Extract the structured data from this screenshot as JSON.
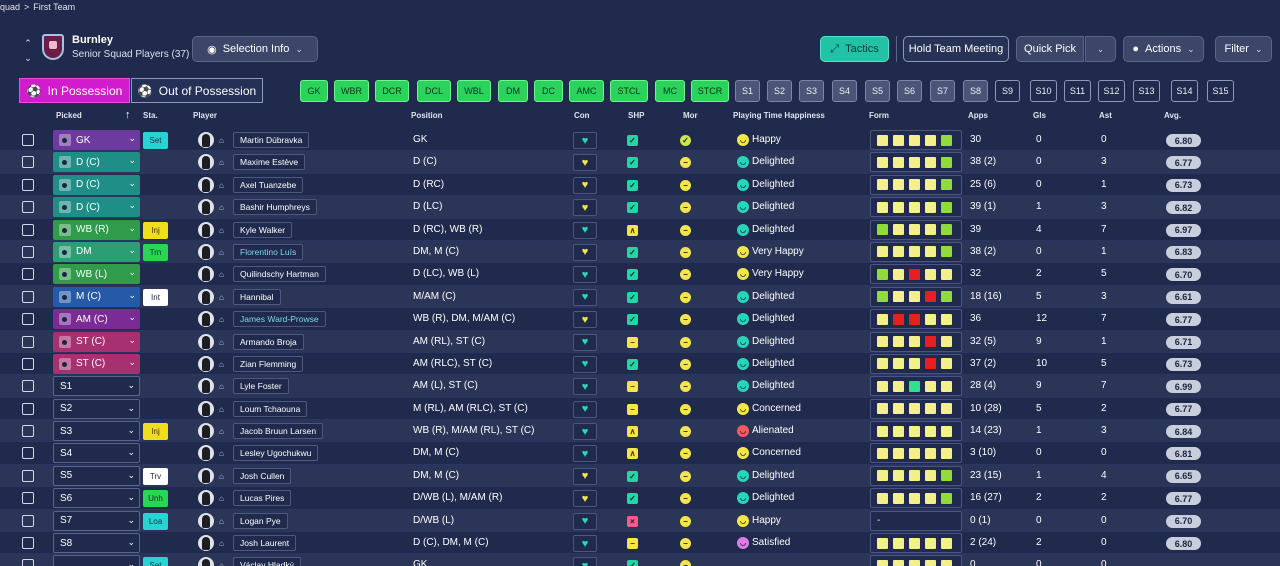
{
  "breadcrumb": [
    "Squad",
    ">",
    "First Team"
  ],
  "club": {
    "name": "Burnley",
    "subtitle": "Senior Squad Players (37)"
  },
  "toolbar": {
    "selection_info": "Selection Info",
    "tactics": "Tactics",
    "hold_team_meeting": "Hold Team Meeting",
    "quick_pick": "Quick Pick",
    "actions": "Actions",
    "filter": "Filter"
  },
  "possession": {
    "in": "In Possession",
    "out": "Out of Possession"
  },
  "position_chips": [
    "GK",
    "WBR",
    "DCR",
    "DCL",
    "WBL",
    "DM",
    "DC",
    "AMC",
    "STCL",
    "MC",
    "STCR",
    "S1",
    "S2",
    "S3",
    "S4",
    "S5",
    "S6",
    "S7",
    "S8",
    "S9",
    "S10",
    "S11",
    "S12",
    "S13",
    "S14",
    "S15"
  ],
  "columns": {
    "picked": "Picked",
    "sta": "Sta.",
    "player": "Player",
    "position": "Position",
    "con": "Con",
    "shp": "SHP",
    "mor": "Mor",
    "pth": "Playing Time Happiness",
    "form": "Form",
    "apps": "Apps",
    "gls": "Gls",
    "ast": "Ast",
    "avg": "Avg."
  },
  "rows": [
    {
      "picked": "GK",
      "sta": "Set",
      "name": "Martin Dúbravka",
      "position": "GK",
      "happiness": "Happy",
      "apps": "30",
      "gls": "0",
      "ast": "0",
      "avg": "6.80"
    },
    {
      "picked": "D (C)",
      "sta": "",
      "name": "Maxime Estève",
      "position": "D (C)",
      "happiness": "Delighted",
      "apps": "38 (2)",
      "gls": "0",
      "ast": "3",
      "avg": "6.77"
    },
    {
      "picked": "D (C)",
      "sta": "",
      "name": "Axel Tuanzebe",
      "position": "D (RC)",
      "happiness": "Delighted",
      "apps": "25 (6)",
      "gls": "0",
      "ast": "1",
      "avg": "6.73"
    },
    {
      "picked": "D (C)",
      "sta": "",
      "name": "Bashir Humphreys",
      "position": "D (LC)",
      "happiness": "Delighted",
      "apps": "39 (1)",
      "gls": "1",
      "ast": "3",
      "avg": "6.82"
    },
    {
      "picked": "WB (R)",
      "sta": "Inj",
      "name": "Kyle Walker",
      "position": "D (RC), WB (R)",
      "happiness": "Delighted",
      "apps": "39",
      "gls": "4",
      "ast": "7",
      "avg": "6.97"
    },
    {
      "picked": "DM",
      "sta": "Trn",
      "name": "Florentino Luís",
      "position": "DM, M (C)",
      "happiness": "Very Happy",
      "apps": "38 (2)",
      "gls": "0",
      "ast": "1",
      "avg": "6.83"
    },
    {
      "picked": "WB (L)",
      "sta": "",
      "name": "Quilindschy Hartman",
      "position": "D (LC), WB (L)",
      "happiness": "Very Happy",
      "apps": "32",
      "gls": "2",
      "ast": "5",
      "avg": "6.70"
    },
    {
      "picked": "M (C)",
      "sta": "Int",
      "name": "Hannibal",
      "position": "M/AM (C)",
      "happiness": "Delighted",
      "apps": "18 (16)",
      "gls": "5",
      "ast": "3",
      "avg": "6.61"
    },
    {
      "picked": "AM (C)",
      "sta": "",
      "name": "James Ward-Prowse",
      "position": "WB (R), DM, M/AM (C)",
      "happiness": "Delighted",
      "apps": "36",
      "gls": "12",
      "ast": "7",
      "avg": "6.77"
    },
    {
      "picked": "ST (C)",
      "sta": "",
      "name": "Armando Broja",
      "position": "AM (RL), ST (C)",
      "happiness": "Delighted",
      "apps": "32 (5)",
      "gls": "9",
      "ast": "1",
      "avg": "6.71"
    },
    {
      "picked": "ST (C)",
      "sta": "",
      "name": "Zian Flemming",
      "position": "AM (RLC), ST (C)",
      "happiness": "Delighted",
      "apps": "37 (2)",
      "gls": "10",
      "ast": "5",
      "avg": "6.73"
    },
    {
      "picked": "S1",
      "sta": "",
      "name": "Lyle Foster",
      "position": "AM (L), ST (C)",
      "happiness": "Delighted",
      "apps": "28 (4)",
      "gls": "9",
      "ast": "7",
      "avg": "6.99"
    },
    {
      "picked": "S2",
      "sta": "",
      "name": "Loum Tchaouna",
      "position": "M (RL), AM (RLC), ST (C)",
      "happiness": "Concerned",
      "apps": "10 (28)",
      "gls": "5",
      "ast": "2",
      "avg": "6.77"
    },
    {
      "picked": "S3",
      "sta": "Inj",
      "name": "Jacob Bruun Larsen",
      "position": "WB (R), M/AM (RL), ST (C)",
      "happiness": "Alienated",
      "apps": "14 (23)",
      "gls": "1",
      "ast": "3",
      "avg": "6.84"
    },
    {
      "picked": "S4",
      "sta": "",
      "name": "Lesley Ugochukwu",
      "position": "DM, M (C)",
      "happiness": "Concerned",
      "apps": "3 (10)",
      "gls": "0",
      "ast": "0",
      "avg": "6.81"
    },
    {
      "picked": "S5",
      "sta": "Trv",
      "name": "Josh Cullen",
      "position": "DM, M (C)",
      "happiness": "Delighted",
      "apps": "23 (15)",
      "gls": "1",
      "ast": "4",
      "avg": "6.65"
    },
    {
      "picked": "S6",
      "sta": "Unh",
      "name": "Lucas Pires",
      "position": "D/WB (L), M/AM (R)",
      "happiness": "Delighted",
      "apps": "16 (27)",
      "gls": "2",
      "ast": "2",
      "avg": "6.77"
    },
    {
      "picked": "S7",
      "sta": "Loa",
      "name": "Logan Pye",
      "position": "D/WB (L)",
      "happiness": "Happy",
      "apps": "0 (1)",
      "gls": "0",
      "ast": "0",
      "avg": "6.70"
    },
    {
      "picked": "S8",
      "sta": "",
      "name": "Josh Laurent",
      "position": "D (C), DM, M (C)",
      "happiness": "Satisfied",
      "apps": "2 (24)",
      "gls": "2",
      "ast": "0",
      "avg": "6.80"
    },
    {
      "picked": "",
      "sta": "Set",
      "name": "Václav Hladký",
      "position": "GK",
      "happiness": "",
      "apps": "0",
      "gls": "0",
      "ast": "0",
      "avg": ""
    }
  ],
  "form_rows": [
    [
      "y",
      "y",
      "y",
      "y",
      "g"
    ],
    [
      "y",
      "y",
      "y",
      "y",
      "g"
    ],
    [
      "y",
      "y",
      "y",
      "y",
      "g"
    ],
    [
      "y",
      "y",
      "y",
      "y",
      "g"
    ],
    [
      "g",
      "y",
      "y",
      "y",
      "g"
    ],
    [
      "y",
      "y",
      "y",
      "y",
      "g"
    ],
    [
      "g",
      "y",
      "r",
      "y",
      "y"
    ],
    [
      "g",
      "y",
      "y",
      "r",
      "g"
    ],
    [
      "y",
      "r",
      "r",
      "y",
      "y"
    ],
    [
      "y",
      "y",
      "y",
      "r",
      "y"
    ],
    [
      "y",
      "y",
      "y",
      "r",
      "y"
    ],
    [
      "y",
      "y",
      "t",
      "y",
      "y"
    ],
    [
      "y",
      "y",
      "y",
      "y",
      "y"
    ],
    [
      "y",
      "y",
      "y",
      "y",
      "y"
    ],
    [
      "y",
      "y",
      "y",
      "y",
      "y"
    ],
    [
      "y",
      "y",
      "y",
      "y",
      "g"
    ],
    [
      "y",
      "y",
      "y",
      "y",
      "g"
    ],
    [
      "-"
    ],
    [
      "y",
      "y",
      "y",
      "y",
      "y"
    ],
    [
      "y",
      "y",
      "y",
      "y",
      "y"
    ]
  ],
  "dot_colors": {
    "y": "#f3f08a",
    "g": "#8fdc3b",
    "r": "#e42020",
    "t": "#2ee08f"
  }
}
